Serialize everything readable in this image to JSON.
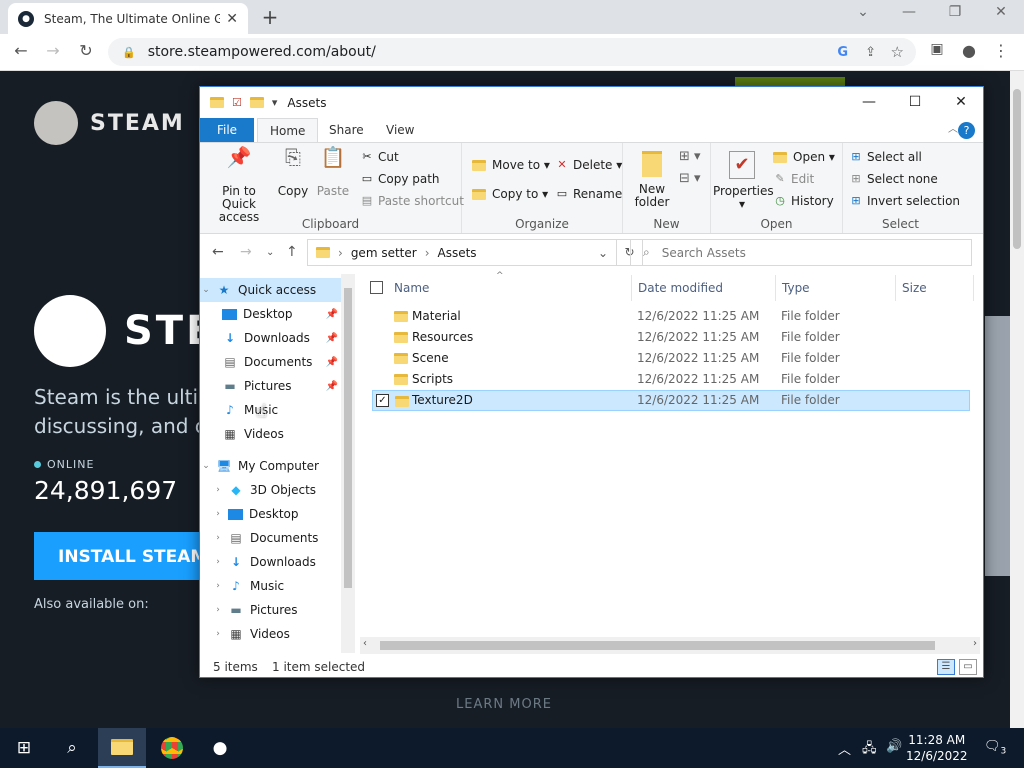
{
  "browser": {
    "tab_title": "Steam, The Ultimate Online Gam",
    "url": "store.steampowered.com/about/"
  },
  "steam": {
    "logo": "STEAM",
    "big_logo": "STE",
    "tagline1": "Steam is the ultim",
    "tagline2": "discussing, and cr",
    "online_label": "ONLINE",
    "online_count": "24,891,697",
    "install": "INSTALL STEAM",
    "also": "Also available on:",
    "learn_more": "LEARN MORE"
  },
  "explorer": {
    "title": "Assets",
    "tabs": [
      "File",
      "Home",
      "Share",
      "View"
    ],
    "clipboard": {
      "pin": "Pin to Quick access",
      "copy": "Copy",
      "paste": "Paste",
      "cut": "Cut",
      "copy_path": "Copy path",
      "paste_shortcut": "Paste shortcut",
      "label": "Clipboard"
    },
    "organize": {
      "move_to": "Move to",
      "copy_to": "Copy to",
      "delete": "Delete",
      "rename": "Rename",
      "label": "Organize"
    },
    "new": {
      "new_folder": "New folder",
      "label": "New"
    },
    "open": {
      "properties": "Properties",
      "open": "Open",
      "edit": "Edit",
      "history": "History",
      "label": "Open"
    },
    "select": {
      "select_all": "Select all",
      "select_none": "Select none",
      "invert": "Invert selection",
      "label": "Select"
    },
    "path": [
      "gem setter",
      "Assets"
    ],
    "search_placeholder": "Search Assets",
    "nav": {
      "quick_access": "Quick access",
      "quick_items": [
        "Desktop",
        "Downloads",
        "Documents",
        "Pictures",
        "Music",
        "Videos"
      ],
      "my_computer": "My Computer",
      "computer_items": [
        "3D Objects",
        "Desktop",
        "Documents",
        "Downloads",
        "Music",
        "Pictures",
        "Videos"
      ]
    },
    "columns": [
      "Name",
      "Date modified",
      "Type",
      "Size"
    ],
    "files": [
      {
        "name": "Material",
        "date": "12/6/2022 11:25 AM",
        "type": "File folder"
      },
      {
        "name": "Resources",
        "date": "12/6/2022 11:25 AM",
        "type": "File folder"
      },
      {
        "name": "Scene",
        "date": "12/6/2022 11:25 AM",
        "type": "File folder"
      },
      {
        "name": "Scripts",
        "date": "12/6/2022 11:25 AM",
        "type": "File folder"
      },
      {
        "name": "Texture2D",
        "date": "12/6/2022 11:25 AM",
        "type": "File folder"
      }
    ],
    "status_items": "5 items",
    "status_selected": "1 item selected"
  },
  "taskbar": {
    "time": "11:28 AM",
    "date": "12/6/2022",
    "notifications": "3"
  }
}
